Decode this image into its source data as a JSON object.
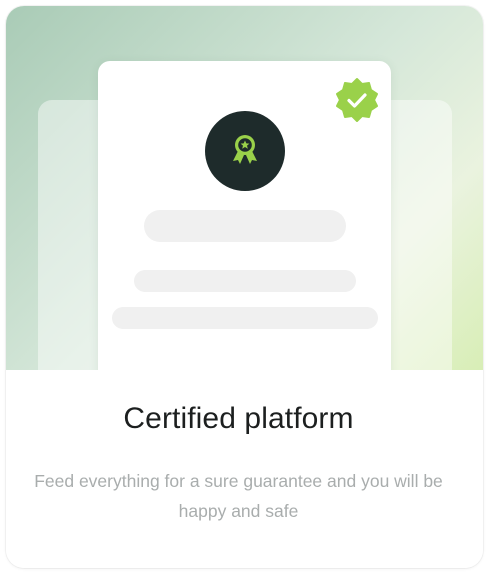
{
  "card": {
    "title": "Certified platform",
    "description": "Feed everything for a sure guarantee and you will be happy and safe"
  },
  "icons": {
    "medal": "award-medal-icon",
    "badge": "verified-check-badge-icon"
  },
  "colors": {
    "accent_green": "#9ad14a",
    "medal_background": "#1e2b2b",
    "title_text": "#1c1f1f",
    "description_text": "#a9adad"
  }
}
